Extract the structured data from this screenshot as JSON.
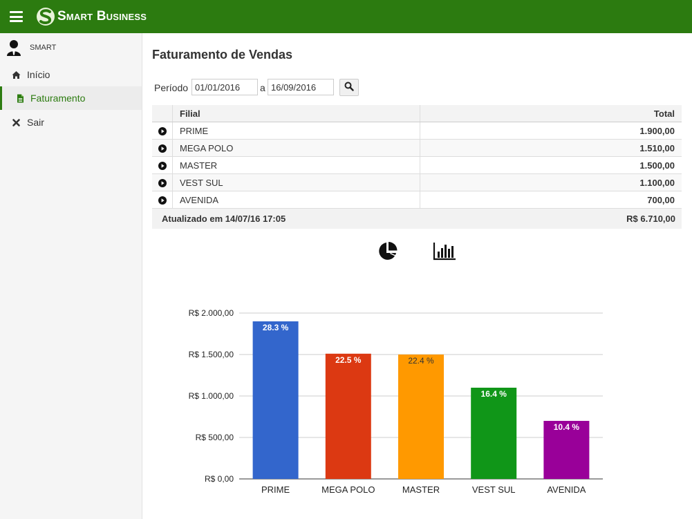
{
  "app": {
    "brand": "Smart Business"
  },
  "user": {
    "name": "SMART"
  },
  "sidebar": {
    "items": [
      {
        "label": "Início",
        "icon": "home-icon"
      },
      {
        "label": "Faturamento",
        "icon": "document-icon",
        "active": true
      },
      {
        "label": "Sair",
        "icon": "close-icon"
      }
    ]
  },
  "page": {
    "title": "Faturamento de Vendas"
  },
  "filter": {
    "label": "Período",
    "from": "01/01/2016",
    "separator": "a",
    "to": "16/09/2016"
  },
  "table": {
    "headers": {
      "filial": "Filial",
      "total": "Total"
    },
    "rows": [
      {
        "filial": "PRIME",
        "total": "1.900,00"
      },
      {
        "filial": "MEGA POLO",
        "total": "1.510,00"
      },
      {
        "filial": "MASTER",
        "total": "1.500,00"
      },
      {
        "filial": "VEST SUL",
        "total": "1.100,00"
      },
      {
        "filial": "AVENIDA",
        "total": "700,00"
      }
    ],
    "footer": {
      "updated": "Atualizado em 14/07/16 17:05",
      "total": "R$ 6.710,00"
    }
  },
  "colors": {
    "accent": "#2c7b10"
  },
  "chart_data": {
    "type": "bar",
    "categories": [
      "PRIME",
      "MEGA POLO",
      "MASTER",
      "VEST SUL",
      "AVENIDA"
    ],
    "values": [
      1900,
      1510,
      1500,
      1100,
      700
    ],
    "data_labels": [
      "28.3 %",
      "22.5 %",
      "22.4 %",
      "16.4 %",
      "10.4 %"
    ],
    "colors": [
      "#3366cc",
      "#dc3912",
      "#ff9900",
      "#109618",
      "#990099"
    ],
    "ylim": [
      0,
      2000
    ],
    "yticks": [
      0,
      500,
      1000,
      1500,
      2000
    ],
    "ytick_labels": [
      "R$ 0,00",
      "R$ 500,00",
      "R$ 1.000,00",
      "R$ 1.500,00",
      "R$ 2.000,00"
    ],
    "grid": true,
    "legend": "none"
  }
}
